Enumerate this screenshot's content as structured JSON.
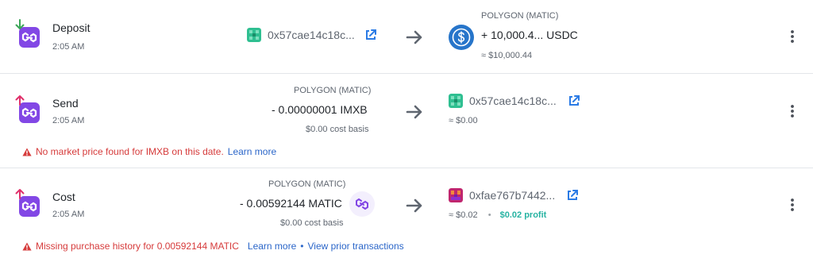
{
  "transactions": [
    {
      "type": "Deposit",
      "time": "2:05 AM",
      "from_address": "0x57cae14c18c...",
      "to_network": "POLYGON (MATIC)",
      "to_amount": "+ 10,000.4... USDC",
      "to_value": "≈ $10,000.44"
    },
    {
      "type": "Send",
      "time": "2:05 AM",
      "from_network": "POLYGON (MATIC)",
      "from_amount": "- 0.00000001 IMXB",
      "from_cost_basis": "$0.00 cost basis",
      "to_address": "0x57cae14c18c...",
      "to_value": "≈ $0.00",
      "warning": "No market price found for IMXB on this date.",
      "warning_link": "Learn more"
    },
    {
      "type": "Cost",
      "time": "2:05 AM",
      "from_network": "POLYGON (MATIC)",
      "from_amount": "- 0.00592144 MATIC",
      "from_cost_basis": "$0.00 cost basis",
      "to_address": "0xfae767b7442...",
      "to_value": "≈ $0.02",
      "to_separator": "•",
      "to_profit": "$0.02 profit",
      "warning": "Missing purchase history for 0.00592144 MATIC",
      "warning_link": "Learn more",
      "warning_sep": "•",
      "warning_link2": "View prior transactions"
    }
  ],
  "icons": {
    "deposit_arrow": "arrow-down-icon",
    "withdraw_arrow": "arrow-up-icon",
    "polygon_link": "polygon-link-icon",
    "external_link": "external-link-icon",
    "flow_arrow": "arrow-right-icon",
    "more": "more-vertical-icon",
    "warning": "warning-triangle-icon",
    "usdc": "usdc-coin-icon",
    "matic": "matic-coin-icon"
  },
  "colors": {
    "polygon_purple": "#8247e5",
    "deposit_green": "#3aa657",
    "withdraw_pink": "#e0306a",
    "link_blue": "#2b66c9",
    "warning_red": "#d63b3b",
    "profit_teal": "#27b3a2",
    "usdc_blue": "#2775ca"
  }
}
